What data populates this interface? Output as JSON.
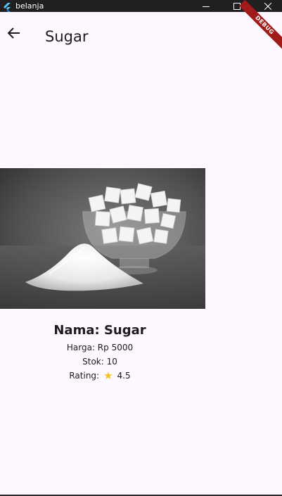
{
  "window": {
    "title": "belanja",
    "controls": {
      "minimize_icon": "minimize-icon",
      "maximize_icon": "maximize-icon",
      "close_icon": "close-icon"
    }
  },
  "appbar": {
    "back_icon": "arrow-back-icon",
    "title": "Sugar"
  },
  "debug_banner": {
    "label": "DEBUG",
    "color": "#a11b1b"
  },
  "product": {
    "image_icon": "sugar-photo",
    "name_line": "Nama: Sugar",
    "price_line": "Harga: Rp 5000",
    "stock_line": "Stok: 10",
    "rating_label": "Rating:",
    "rating_icon": "star-icon",
    "rating_value": "4.5"
  },
  "colors": {
    "background": "#fdf7ff",
    "titlebar": "#202020",
    "star": "#f5c518",
    "text": "#1d1b20"
  }
}
